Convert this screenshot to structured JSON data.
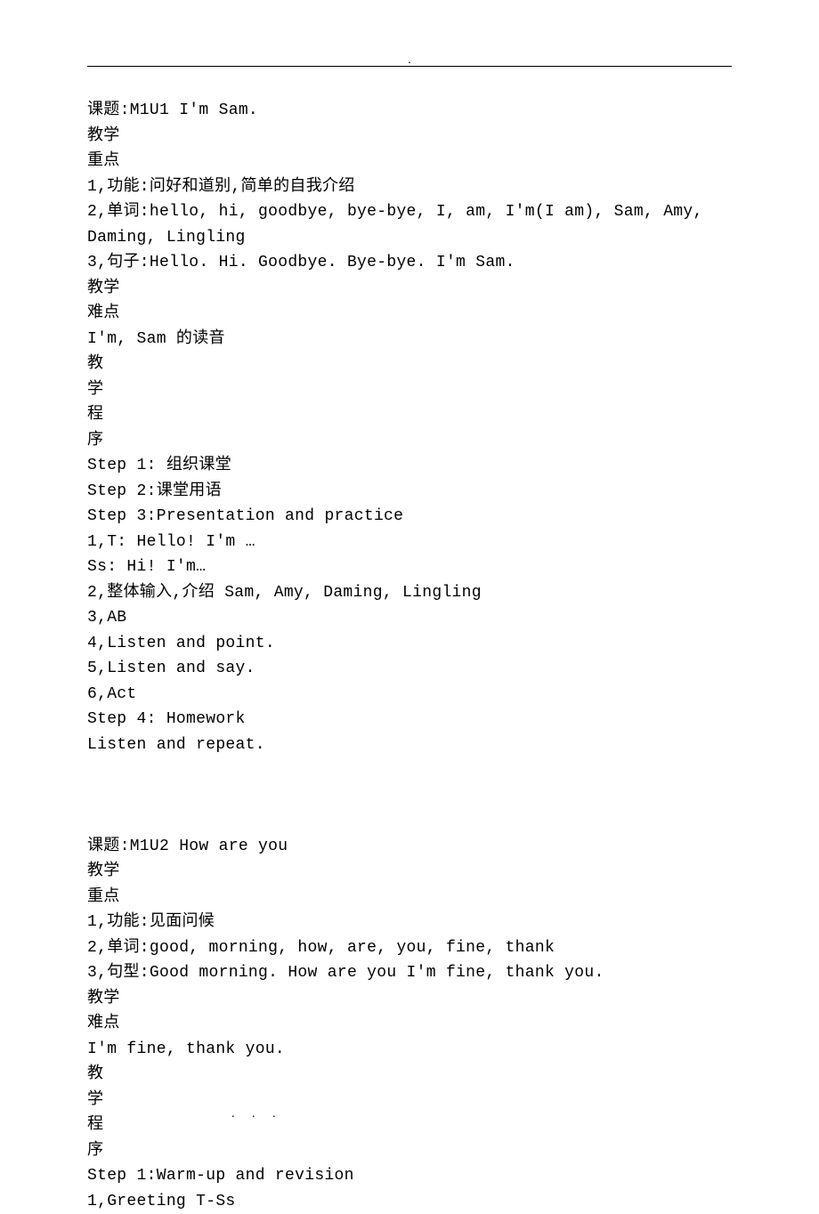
{
  "header": {
    "top_mark": "."
  },
  "lessons": [
    {
      "title": "课题:M1U1 I'm Sam.",
      "key_points_label": "教学\n重点",
      "key_points": [
        "1,功能:问好和道别,简单的自我介绍",
        "2,单词:hello, hi, goodbye, bye-bye, I, am, I'm(I am), Sam, Amy, Daming, Lingling",
        "3,句子:Hello. Hi. Goodbye. Bye-bye. I'm Sam."
      ],
      "difficulty_label": "教学\n难点",
      "difficulty": "I'm, Sam 的读音",
      "procedure_label": "教\n学\n程\n序",
      "procedure": [
        "Step 1: 组织课堂",
        "Step 2:课堂用语",
        "Step 3:Presentation and practice",
        "1,T: Hello! I'm …",
        "Ss: Hi! I'm…",
        "2,整体输入,介绍 Sam, Amy, Daming, Lingling",
        "3,AB",
        "4,Listen and point.",
        "5,Listen and say.",
        "6,Act",
        "Step 4: Homework",
        "Listen and repeat."
      ]
    },
    {
      "title": "课题:M1U2 How are you",
      "key_points_label": "教学\n重点",
      "key_points": [
        "1,功能:见面问候",
        "2,单词:good, morning, how, are, you, fine, thank",
        "3,句型:Good morning. How are you I'm fine, thank you."
      ],
      "difficulty_label": "教学\n难点",
      "difficulty": "I'm fine, thank you.",
      "procedure_label": "教\n学\n程\n序",
      "procedure": [
        "Step 1:Warm-up and revision",
        "1,Greeting T-Ss"
      ]
    }
  ],
  "footer": {
    "dots": ".  .  ."
  }
}
